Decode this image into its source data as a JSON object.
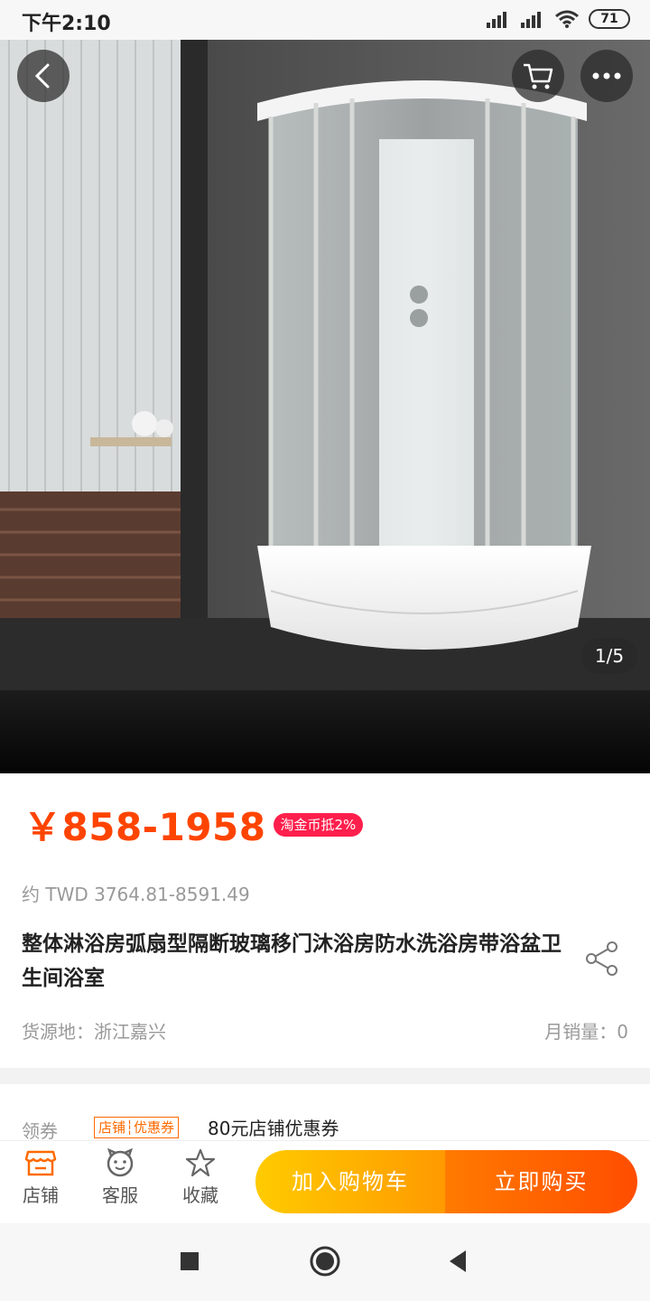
{
  "status_bar": {
    "time": "下午2:10",
    "battery": "71"
  },
  "hero": {
    "page_indicator": "1/5",
    "icons": [
      "back-arrow-icon",
      "cart-icon",
      "more-icon"
    ]
  },
  "product": {
    "price": "￥858-1958",
    "coin_badge": "淘金币抵2%",
    "twd_price": "约 TWD 3764.81-8591.49",
    "title": "整体淋浴房弧扇型隔断玻璃移门沐浴房防水洗浴房带浴盆卫生间浴室",
    "origin": "货源地：浙江嘉兴",
    "monthly_sales": "月销量：0"
  },
  "coupon": {
    "label": "领券",
    "tag": "店铺┆优惠券",
    "text": "80元店铺优惠券"
  },
  "action_bar": {
    "store_label": "店铺",
    "service_label": "客服",
    "favorite_label": "收藏",
    "add_to_cart_label": "加入购物车",
    "buy_now_label": "立即购买"
  },
  "colors": {
    "price": "#ff4400",
    "badge": "#ff1f4c",
    "cart_button": "#ffa800",
    "buy_button": "#ff5a00"
  }
}
